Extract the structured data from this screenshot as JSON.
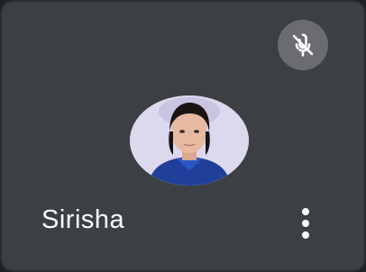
{
  "participant": {
    "name": "Sirisha",
    "muted": true,
    "avatar_icon": "user-photo-avatar"
  },
  "controls": {
    "mic_status_icon": "mic-off-icon",
    "more_options_icon": "more-vert-icon"
  },
  "colors": {
    "tile_background": "#3c4043",
    "page_background": "#202124",
    "mic_badge_background": "#6a6c70",
    "text": "#ffffff"
  }
}
